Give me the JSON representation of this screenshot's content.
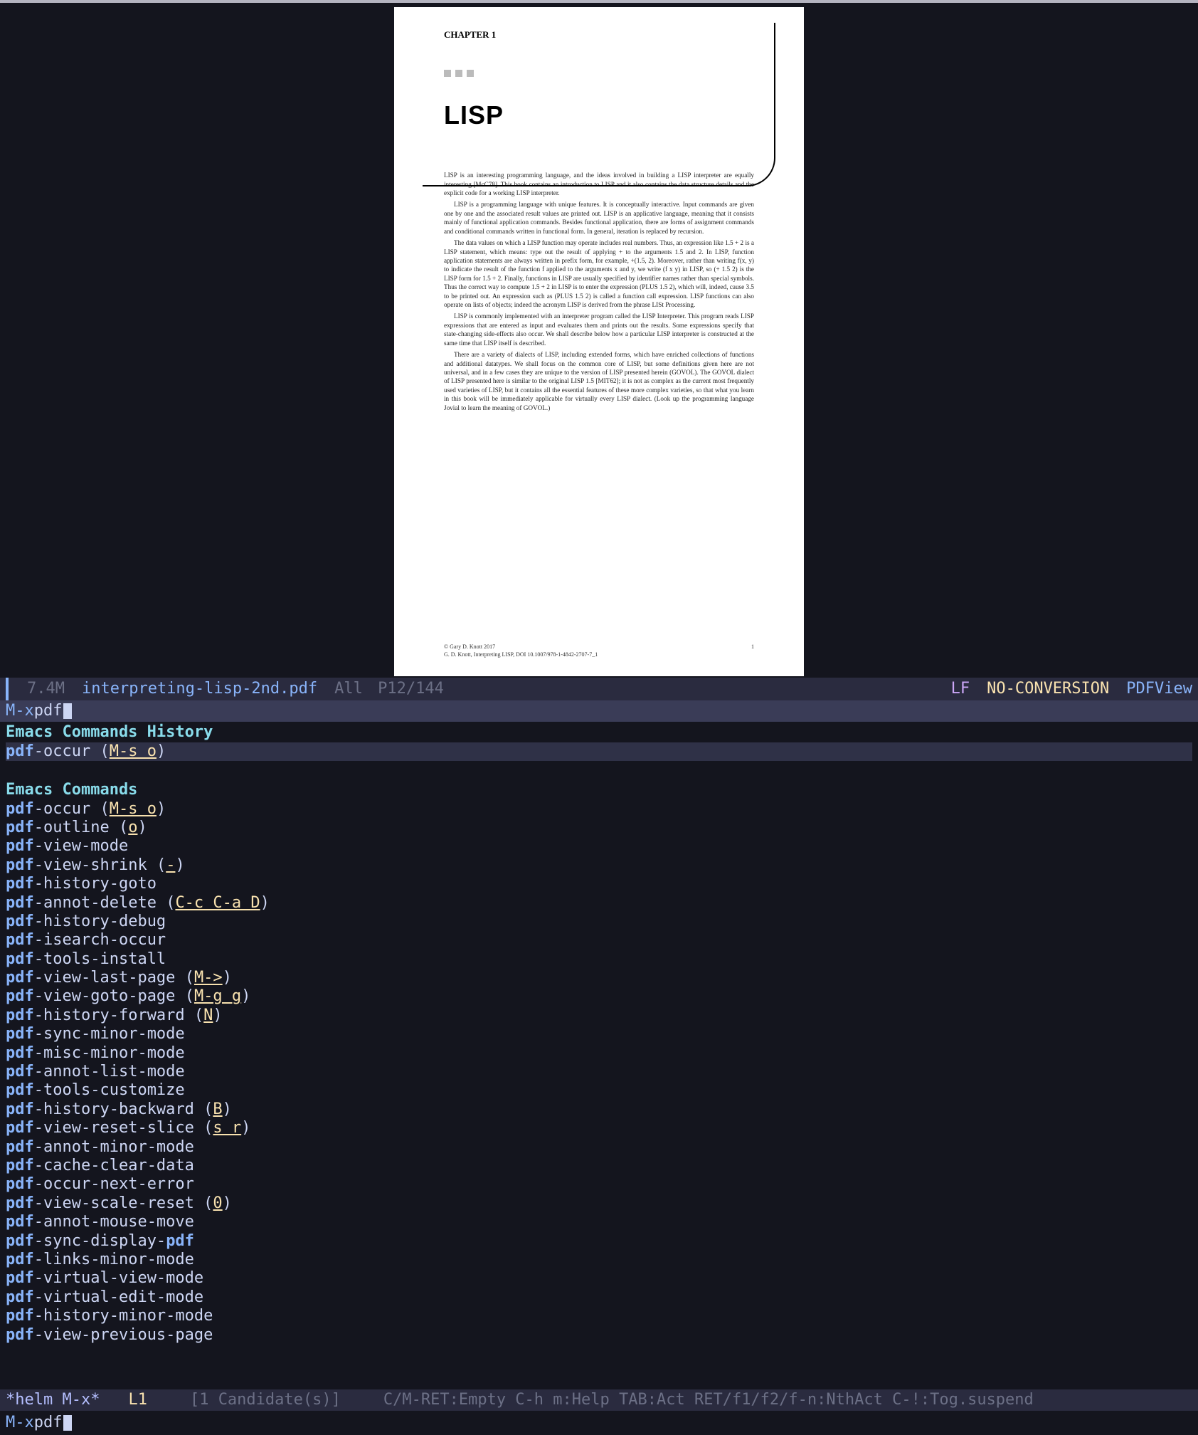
{
  "pdf": {
    "chapter_label": "CHAPTER 1",
    "title": "LISP",
    "para1": "LISP is an interesting programming language, and the ideas involved in building a LISP interpreter are equally interesting [McC78]. This book contains an introduction to LISP and it also contains the data structure details and the explicit code for a working LISP interpreter.",
    "para2": "LISP is a programming language with unique features. It is conceptually interactive. Input commands are given one by one and the associated result values are printed out. LISP is an applicative language, meaning that it consists mainly of functional application commands. Besides functional application, there are forms of assignment commands and conditional commands written in functional form. In general, iteration is replaced by recursion.",
    "para3": "The data values on which a LISP function may operate includes real numbers. Thus, an expression like 1.5 + 2 is a LISP statement, which means: type out the result of applying + to the arguments 1.5 and 2. In LISP, function application statements are always written in prefix form, for example, +(1.5, 2). Moreover, rather than writing f(x, y) to indicate the result of the function f applied to the arguments x and y, we write (f x y) in LISP, so (+ 1.5 2) is the LISP form for 1.5 + 2. Finally, functions in LISP are usually specified by identifier names rather than special symbols. Thus the correct way to compute 1.5 + 2 in LISP is to enter the expression (PLUS 1.5 2), which will, indeed, cause 3.5 to be printed out. An expression such as (PLUS 1.5 2) is called a function call expression. LISP functions can also operate on lists of objects; indeed the acronym LISP is derived from the phrase LISt Processing.",
    "para4": "LISP is commonly implemented with an interpreter program called the LISP Interpreter. This program reads LISP expressions that are entered as input and evaluates them and prints out the results. Some expressions specify that state-changing side-effects also occur. We shall describe below how a particular LISP interpreter is constructed at the same time that LISP itself is described.",
    "para5": "There are a variety of dialects of LISP, including extended forms, which have enriched collections of functions and additional datatypes. We shall focus on the common core of LISP, but some definitions given here are not universal, and in a few cases they are unique to the version of LISP presented herein (GOVOL). The GOVOL dialect of LISP presented here is similar to the original LISP 1.5 [MIT62]; it is not as complex as the current most frequently used varieties of LISP, but it contains all the essential features of these more complex varieties, so that what you learn in this book will be immediately applicable for virtually every LISP dialect. (Look up the programming language Jovial to learn the meaning of GOVOL.)",
    "copyright1": "© Gary D. Knott 2017",
    "copyright2": "G. D. Knott, Interpreting LISP, DOI 10.1007/978-1-4842-2707-7_1",
    "page_number": "1"
  },
  "modeline": {
    "size": "7.4M",
    "filename": "interpreting-lisp-2nd.pdf",
    "all": "All",
    "page": "P12/144",
    "eol": "LF",
    "coding": "NO-CONVERSION",
    "mode": "PDFView"
  },
  "minibuffer": {
    "prompt": "M-x ",
    "input": "pdf"
  },
  "helm": {
    "history_header": "Emacs Commands History",
    "history": [
      {
        "cmd": "pdf-occur",
        "key": "M-s o"
      }
    ],
    "commands_header": "Emacs Commands",
    "commands": [
      {
        "prefix": "pdf",
        "rest": "-occur",
        "key": "M-s o"
      },
      {
        "prefix": "pdf",
        "rest": "-outline",
        "key": "o"
      },
      {
        "prefix": "pdf",
        "rest": "-view-mode",
        "key": ""
      },
      {
        "prefix": "pdf",
        "rest": "-view-shrink",
        "key": "-"
      },
      {
        "prefix": "pdf",
        "rest": "-history-goto",
        "key": ""
      },
      {
        "prefix": "pdf",
        "rest": "-annot-delete",
        "key": "C-c C-a D"
      },
      {
        "prefix": "pdf",
        "rest": "-history-debug",
        "key": ""
      },
      {
        "prefix": "pdf",
        "rest": "-isearch-occur",
        "key": ""
      },
      {
        "prefix": "pdf",
        "rest": "-tools-install",
        "key": ""
      },
      {
        "prefix": "pdf",
        "rest": "-view-last-page",
        "key": "M->"
      },
      {
        "prefix": "pdf",
        "rest": "-view-goto-page",
        "key": "M-g g"
      },
      {
        "prefix": "pdf",
        "rest": "-history-forward",
        "key": "N"
      },
      {
        "prefix": "pdf",
        "rest": "-sync-minor-mode",
        "key": ""
      },
      {
        "prefix": "pdf",
        "rest": "-misc-minor-mode",
        "key": ""
      },
      {
        "prefix": "pdf",
        "rest": "-annot-list-mode",
        "key": ""
      },
      {
        "prefix": "pdf",
        "rest": "-tools-customize",
        "key": ""
      },
      {
        "prefix": "pdf",
        "rest": "-history-backward",
        "key": "B"
      },
      {
        "prefix": "pdf",
        "rest": "-view-reset-slice",
        "key": "s r"
      },
      {
        "prefix": "pdf",
        "rest": "-annot-minor-mode",
        "key": ""
      },
      {
        "prefix": "pdf",
        "rest": "-cache-clear-data",
        "key": ""
      },
      {
        "prefix": "pdf",
        "rest": "-occur-next-error",
        "key": ""
      },
      {
        "prefix": "pdf",
        "rest": "-view-scale-reset",
        "key": "0"
      },
      {
        "prefix": "pdf",
        "rest": "-annot-mouse-move",
        "key": ""
      },
      {
        "prefix": "pdf",
        "rest": "-sync-display-",
        "trail_hl": "pdf",
        "key": ""
      },
      {
        "prefix": "pdf",
        "rest": "-links-minor-mode",
        "key": ""
      },
      {
        "prefix": "pdf",
        "rest": "-virtual-view-mode",
        "key": ""
      },
      {
        "prefix": "pdf",
        "rest": "-virtual-edit-mode",
        "key": ""
      },
      {
        "prefix": "pdf",
        "rest": "-history-minor-mode",
        "key": ""
      },
      {
        "prefix": "pdf",
        "rest": "-view-previous-page",
        "key": ""
      }
    ]
  },
  "modeline2": {
    "bufname": "*helm M-x*",
    "pos": "L1",
    "candidates": "[1 Candidate(s)]",
    "hints": "C/M-RET:Empty C-h m:Help TAB:Act RET/f1/f2/f-n:NthAct C-!:Tog.suspend"
  },
  "minibuffer2": {
    "prompt": "M-x ",
    "input": "pdf"
  }
}
